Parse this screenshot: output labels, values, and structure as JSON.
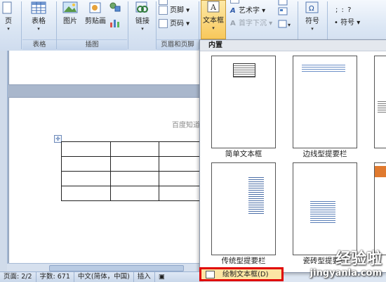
{
  "ribbon": {
    "page_btn": "页",
    "table_btn": "表格",
    "picture_btn": "图片",
    "clipart_btn": "剪贴画",
    "link_btn": "链接",
    "textbox_btn": "文本框",
    "symbol_btn": "符号",
    "small": {
      "footer": "页脚",
      "page_number": "页码",
      "wordart": "艺术字",
      "dropcap": "首字下沉",
      "symbol_small": "符号",
      "dot_row": ";  :  ?"
    },
    "groups": {
      "table": "表格",
      "illustrations": "插图",
      "header_footer": "页眉和页脚"
    }
  },
  "document": {
    "header_text": "百度知道"
  },
  "panel": {
    "header": "内置",
    "items": [
      {
        "label": "简单文本框"
      },
      {
        "label": "边线型提要栏"
      },
      {
        "label": "传统型提要栏"
      },
      {
        "label": "瓷砖型提要栏"
      }
    ],
    "draw_textbox": "绘制文本框(D)"
  },
  "status": {
    "page": "页面: 2/2",
    "words": "字数: 671",
    "language": "中文(简体，中国)",
    "mode": "插入"
  },
  "watermark": {
    "title": "经验啦",
    "url": "jingyanla.com"
  }
}
